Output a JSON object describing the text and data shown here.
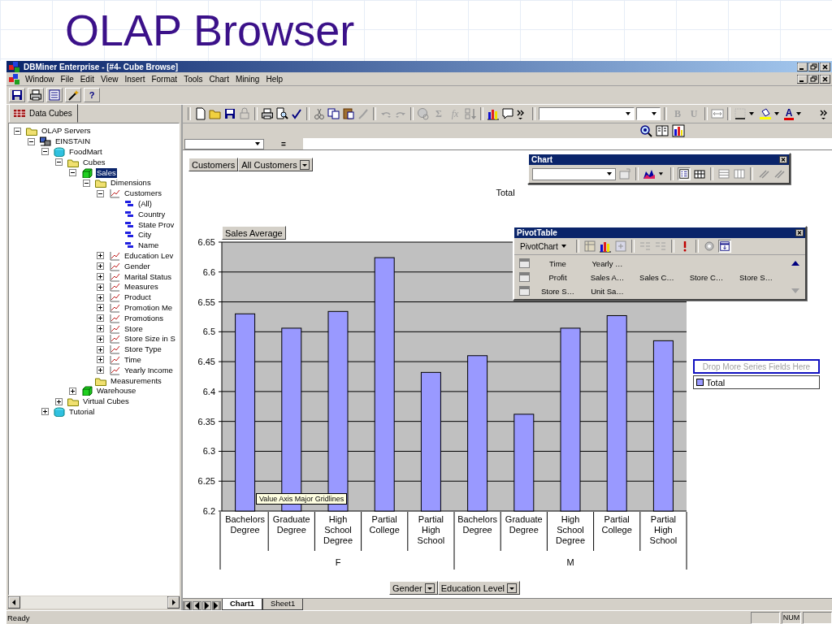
{
  "slide": {
    "title": "OLAP Browser"
  },
  "window": {
    "title": "DBMiner Enterprise - [#4- Cube Browse]"
  },
  "menu": [
    "Window",
    "File",
    "Edit",
    "View",
    "Insert",
    "Format",
    "Tools",
    "Chart",
    "Mining",
    "Help"
  ],
  "toolbar": {
    "help_label": "?"
  },
  "sidebar": {
    "tab": "Data Cubes",
    "tree": [
      {
        "label": "OLAP Servers",
        "kind": "folder",
        "expanded": true,
        "selected": false,
        "children": [
          {
            "label": "EINSTAIN",
            "kind": "server",
            "expanded": true,
            "selected": false,
            "children": [
              {
                "label": "FoodMart",
                "kind": "database",
                "expanded": true,
                "selected": false,
                "children": [
                  {
                    "label": "Cubes",
                    "kind": "folder",
                    "expanded": true,
                    "selected": false,
                    "children": [
                      {
                        "label": "Sales",
                        "kind": "cube",
                        "expanded": true,
                        "selected": true,
                        "children": [
                          {
                            "label": "Dimensions",
                            "kind": "folder",
                            "expanded": true,
                            "selected": false,
                            "children": [
                              {
                                "label": "Customers",
                                "kind": "dimension",
                                "expanded": true,
                                "selected": false,
                                "children": [
                                  {
                                    "label": "(All)",
                                    "kind": "level",
                                    "selected": false
                                  },
                                  {
                                    "label": "Country",
                                    "kind": "level",
                                    "selected": false
                                  },
                                  {
                                    "label": "State Prov",
                                    "kind": "level",
                                    "selected": false
                                  },
                                  {
                                    "label": "City",
                                    "kind": "level",
                                    "selected": false
                                  },
                                  {
                                    "label": "Name",
                                    "kind": "level",
                                    "selected": false
                                  }
                                ]
                              },
                              {
                                "label": "Education Lev",
                                "kind": "dimension",
                                "expanded": false,
                                "selected": false
                              },
                              {
                                "label": "Gender",
                                "kind": "dimension",
                                "expanded": false,
                                "selected": false
                              },
                              {
                                "label": "Marital Status",
                                "kind": "dimension",
                                "expanded": false,
                                "selected": false
                              },
                              {
                                "label": "Measures",
                                "kind": "dimension",
                                "expanded": false,
                                "selected": false
                              },
                              {
                                "label": "Product",
                                "kind": "dimension",
                                "expanded": false,
                                "selected": false
                              },
                              {
                                "label": "Promotion Me",
                                "kind": "dimension",
                                "expanded": false,
                                "selected": false
                              },
                              {
                                "label": "Promotions",
                                "kind": "dimension",
                                "expanded": false,
                                "selected": false
                              },
                              {
                                "label": "Store",
                                "kind": "dimension",
                                "expanded": false,
                                "selected": false
                              },
                              {
                                "label": "Store Size in S",
                                "kind": "dimension",
                                "expanded": false,
                                "selected": false
                              },
                              {
                                "label": "Store Type",
                                "kind": "dimension",
                                "expanded": false,
                                "selected": false
                              },
                              {
                                "label": "Time",
                                "kind": "dimension",
                                "expanded": false,
                                "selected": false
                              },
                              {
                                "label": "Yearly Income",
                                "kind": "dimension",
                                "expanded": false,
                                "selected": false
                              }
                            ]
                          },
                          {
                            "label": "Measurements",
                            "kind": "folder",
                            "selected": false
                          }
                        ]
                      },
                      {
                        "label": "Warehouse",
                        "kind": "cube",
                        "expanded": false,
                        "selected": false
                      }
                    ]
                  },
                  {
                    "label": "Virtual Cubes",
                    "kind": "folder",
                    "expanded": false,
                    "selected": false
                  }
                ]
              },
              {
                "label": "Tutorial",
                "kind": "database",
                "expanded": false,
                "selected": false
              }
            ]
          }
        ]
      }
    ]
  },
  "format_toolbar": {
    "sum_button": {
      "label": "Σ",
      "disabled": true
    },
    "function_button": {
      "label": "fx",
      "disabled": true
    },
    "bold_button": {
      "label": "B",
      "disabled": true
    },
    "underline_button": {
      "label": "U",
      "disabled": true
    },
    "font_color_button": {
      "label": "A",
      "disabled": false
    }
  },
  "formula_bar": {
    "operator": "="
  },
  "chart_toolbar": {
    "title": "Chart"
  },
  "pivot_table_toolbar": {
    "title": "PivotTable",
    "menu": "PivotChart",
    "field_rows": [
      {
        "fields": [
          "Time",
          "Yearly …"
        ]
      },
      {
        "fields": [
          "Profit",
          "Sales A…",
          "Sales C…",
          "Store C…",
          "Store S…"
        ]
      },
      {
        "fields": [
          "Store S…",
          "Unit Sa…"
        ]
      }
    ]
  },
  "chart": {
    "page_field": {
      "label": "Customers",
      "value": "All Customers"
    },
    "data_field": "Sales Average",
    "tooltip": "Value Axis Major Gridlines",
    "legend": {
      "drop_zone": "Drop More Series Fields Here"
    },
    "category_fields": [
      "Gender",
      "Education Level"
    ],
    "category_groups": [
      {
        "label": "F"
      },
      {
        "label": "M"
      }
    ],
    "chart_data": {
      "type": "bar",
      "title": "Total",
      "categories": [
        "Bachelors Degree",
        "Graduate Degree",
        "High School Degree",
        "Partial College",
        "Partial High School",
        "Bachelors Degree",
        "Graduate Degree",
        "High School Degree",
        "Partial College",
        "Partial High School"
      ],
      "series": [
        {
          "name": "Total",
          "color": "#9999ff",
          "values": [
            6.53,
            6.506,
            6.534,
            6.624,
            6.432,
            6.46,
            6.362,
            6.506,
            6.527,
            6.485
          ]
        }
      ],
      "ylim": [
        6.2,
        6.65
      ],
      "grid": true,
      "yticks": [
        6.2,
        6.25,
        6.3,
        6.35,
        6.4,
        6.45,
        6.5,
        6.55,
        6.6,
        6.65
      ]
    }
  },
  "sheet_tabs": [
    {
      "label": "Chart1",
      "selected": true
    },
    {
      "label": "Sheet1",
      "selected": false
    }
  ],
  "status_bar": {
    "message": "Ready",
    "indicators": [
      "NUM"
    ]
  }
}
